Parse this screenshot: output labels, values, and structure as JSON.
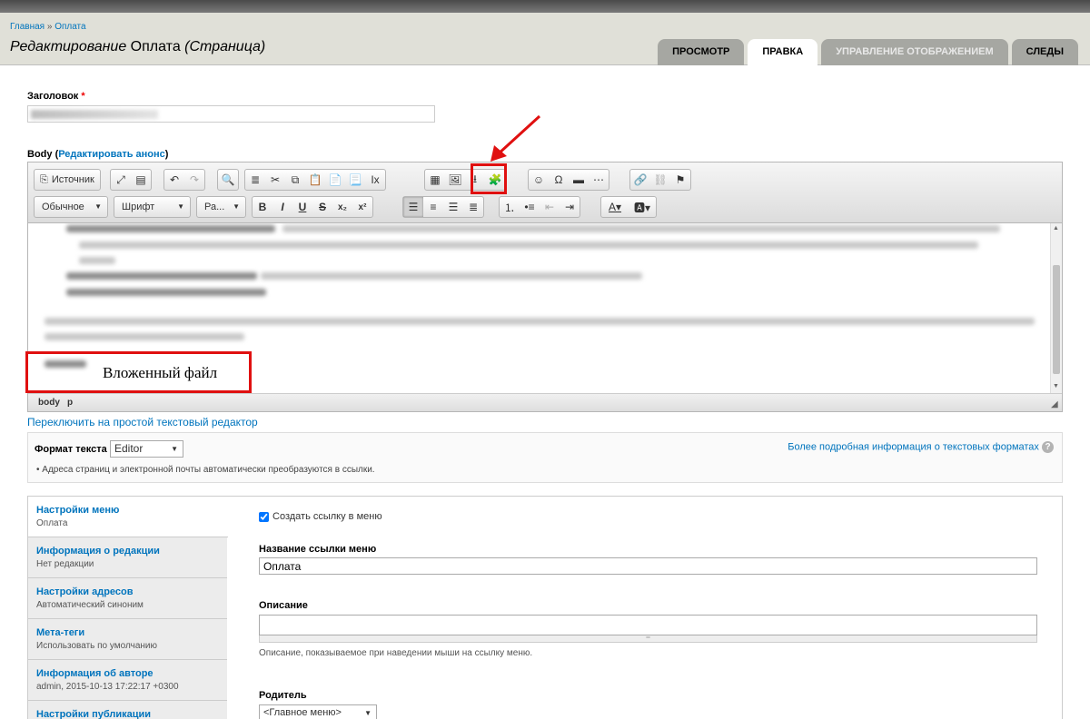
{
  "breadcrumb": {
    "home": "Главная",
    "sep": "»",
    "current": "Оплата"
  },
  "title": {
    "prefix": "Редактирование",
    "name": "Оплата",
    "type": "(Страница)"
  },
  "tabs": [
    "ПРОСМОТР",
    "ПРАВКА",
    "УПРАВЛЕНИЕ ОТОБРАЖЕНИЕМ",
    "СЛЕДЫ"
  ],
  "active_tab": "ПРАВКА",
  "title_field": {
    "label": "Заголовок",
    "required_mark": "*"
  },
  "body": {
    "label": "Body",
    "open_paren": "(",
    "summary_link": "Редактировать анонс",
    "close_paren": ")"
  },
  "toolbar": {
    "source": "Источник",
    "format": "Обычное",
    "font": "Шрифт",
    "size": "Ра..."
  },
  "statusbar": {
    "path1": "body",
    "path2": "p"
  },
  "annotation": {
    "label": "Вложенный файл"
  },
  "switch_editor": "Переключить на простой текстовый редактор",
  "text_format": {
    "label": "Формат текста",
    "value": "Editor",
    "more_info": "Более подробная информация о текстовых форматах",
    "tip": "Адреса страниц и электронной почты автоматически преобразуются в ссылки."
  },
  "vtabs": [
    {
      "title": "Настройки меню",
      "summary": "Оплата"
    },
    {
      "title": "Информация о редакции",
      "summary": "Нет редакции"
    },
    {
      "title": "Настройки адресов",
      "summary": "Автоматический синоним"
    },
    {
      "title": "Мета-теги",
      "summary": "Использовать по умолчанию"
    },
    {
      "title": "Информация об авторе",
      "summary": "admin, 2015-10-13 17:22:17 +0300"
    },
    {
      "title": "Настройки публикации",
      "summary": ""
    }
  ],
  "menu_settings": {
    "create_link_label": "Создать ссылку в меню",
    "create_link_checked": true,
    "link_title_label": "Название ссылки меню",
    "link_title_value": "Оплата",
    "description_label": "Описание",
    "description_value": "",
    "description_help": "Описание, показываемое при наведении мыши на ссылку меню.",
    "parent_label": "Родитель",
    "parent_value": "<Главное меню>"
  },
  "colors": {
    "link": "#0074bd",
    "annotation_red": "#e01010",
    "header_bg": "#e0e0d8",
    "tab_bg": "#a6a7a2"
  }
}
